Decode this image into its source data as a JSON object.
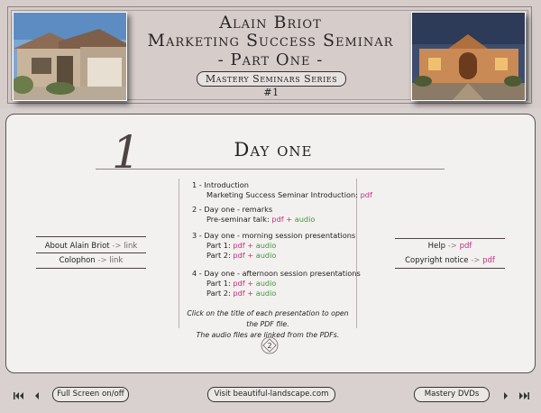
{
  "header": {
    "title_line1": "Alain Briot",
    "title_line2": "Marketing Success Seminar",
    "title_line3": "- Part One -",
    "series_badge": "Mastery Seminars Series #1"
  },
  "main": {
    "day_number": "1",
    "day_title": "Day one",
    "sections": [
      {
        "title": "1 - Introduction",
        "rows": [
          {
            "label": "Marketing Success Seminar Introduction:",
            "pdf": "pdf",
            "audio": ""
          }
        ]
      },
      {
        "title": "2 - Day one - remarks",
        "rows": [
          {
            "label": "Pre-seminar talk:",
            "pdf": "pdf",
            "plus": "+",
            "audio": "audio"
          }
        ]
      },
      {
        "title": "3 - Day one - morning session presentations",
        "rows": [
          {
            "label": "Part 1:",
            "pdf": "pdf",
            "plus": "+",
            "audio": "audio"
          },
          {
            "label": "Part 2:",
            "pdf": "pdf",
            "plus": "+",
            "audio": "audio"
          }
        ]
      },
      {
        "title": "4 - Day one - afternoon session presentations",
        "rows": [
          {
            "label": "Part 1:",
            "pdf": "pdf",
            "plus": "+",
            "audio": "audio"
          },
          {
            "label": "Part 2:",
            "pdf": "pdf",
            "plus": "+",
            "audio": "audio"
          }
        ]
      }
    ],
    "note_line1": "Click on the title of each presentation to open the PDF file.",
    "note_line2": "The audio files are linked from the PDFs.",
    "page_number": "2"
  },
  "left_links": [
    {
      "label": "About Alain Briot",
      "arrow": "->",
      "target": "link"
    },
    {
      "label": "Colophon",
      "arrow": "->",
      "target": "link"
    }
  ],
  "right_links": [
    {
      "label": "Help",
      "arrow": "->",
      "target": "pdf"
    },
    {
      "label": "Copyright notice",
      "arrow": "->",
      "target": "pdf"
    }
  ],
  "footer": {
    "fullscreen": "Full Screen on/off",
    "website": "Visit beautiful-landscape.com",
    "dvds": "Mastery DVDs"
  },
  "colors": {
    "pdf_link": "#c0307a",
    "audio_link": "#3a9a3a",
    "background": "#d9d1cf"
  }
}
